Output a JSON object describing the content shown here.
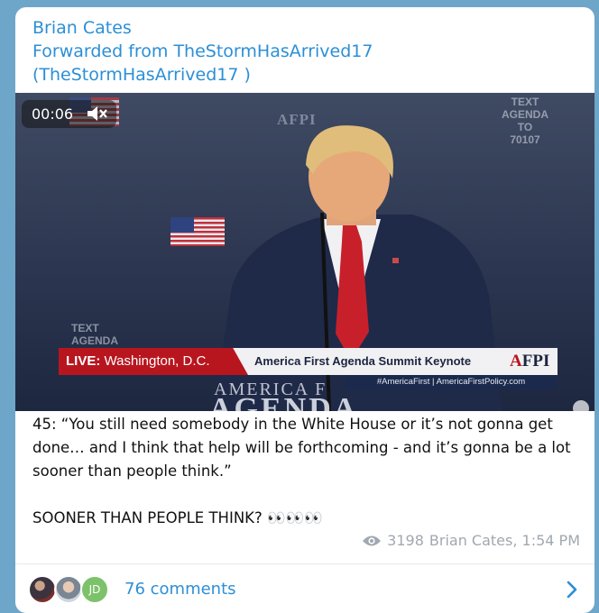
{
  "post": {
    "author": "Brian Cates",
    "forwarded_from": "Forwarded from TheStormHasArrived17 (TheStormHasArrived17 )"
  },
  "video": {
    "time": "00:06",
    "muted": true,
    "watermark_afpi": "AFPI",
    "text_agenda_top": [
      "TEXT",
      "AGENDA",
      "TO",
      "70107"
    ],
    "text_agenda_left": [
      "TEXT",
      "AGENDA"
    ],
    "live_label": "LIVE:",
    "live_location": "Washington, D.C.",
    "summit_title": "America First Agenda Summit Keynote",
    "logo_text": "FPI",
    "logo_first_letter": "A",
    "hashtag_line": "#AmericaFirst | AmericaFirstPolicy.com",
    "podium_line1": "AMERICA F",
    "podium_line2": "AGENDA"
  },
  "message": {
    "quote": "45: “You still need somebody in the White House or it’s not gonna get done… and I think that help will be forthcoming - and it’s gonna be a lot sooner than people think.”",
    "emphasis": "SOONER THAN PEOPLE THINK?",
    "emoji": "👀👀👀"
  },
  "meta": {
    "views": "3198",
    "signature": "Brian Cates, 1:54 PM",
    "view_icon": "eye-icon"
  },
  "footer": {
    "avatar3_initials": "JD",
    "comments_label": "76 comments",
    "chevron_icon": "chevron-right-icon"
  },
  "colors": {
    "accent": "#2c8fd6",
    "background": "#6ea6c9",
    "live_red": "#b8161f"
  }
}
